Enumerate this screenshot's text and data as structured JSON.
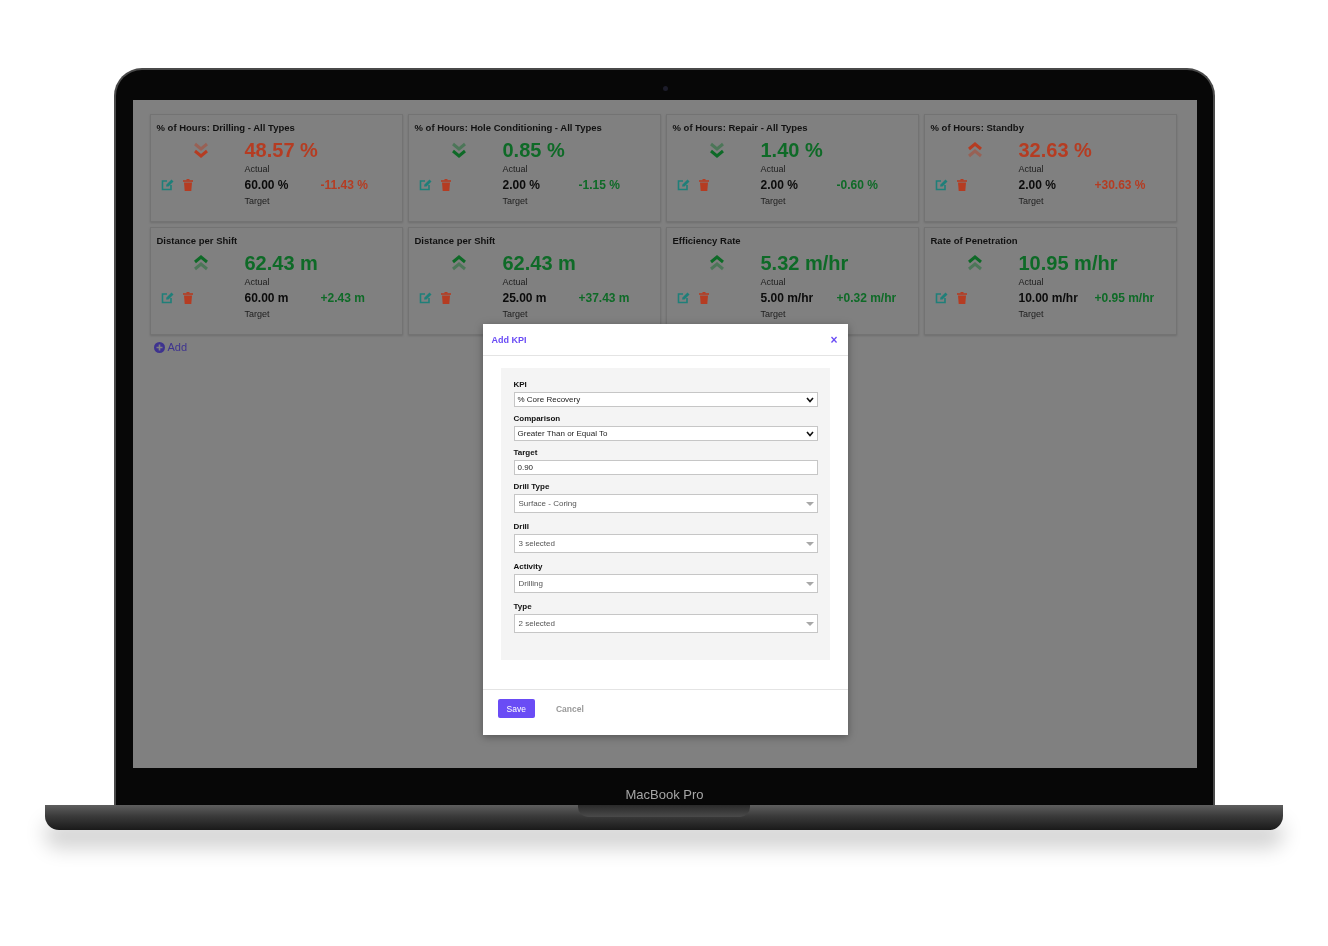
{
  "cards": [
    {
      "title": "% of Hours: Drilling - All Types",
      "rising": false,
      "on_target": false,
      "actual": "48.57 %",
      "actual_label": "Actual",
      "target": "60.00 %",
      "target_label": "Target",
      "difference": "-11.43 %"
    },
    {
      "title": "% of Hours: Hole Conditioning - All Types",
      "rising": false,
      "on_target": true,
      "actual": "0.85 %",
      "actual_label": "Actual",
      "target": "2.00 %",
      "target_label": "Target",
      "difference": "-1.15 %"
    },
    {
      "title": "% of Hours: Repair - All Types",
      "rising": false,
      "on_target": true,
      "actual": "1.40 %",
      "actual_label": "Actual",
      "target": "2.00 %",
      "target_label": "Target",
      "difference": "-0.60 %"
    },
    {
      "title": "% of Hours: Standby",
      "rising": true,
      "on_target": false,
      "actual": "32.63 %",
      "actual_label": "Actual",
      "target": "2.00 %",
      "target_label": "Target",
      "difference": "+30.63 %"
    },
    {
      "title": "Distance per Shift",
      "rising": true,
      "on_target": true,
      "actual": "62.43 m",
      "actual_label": "Actual",
      "target": "60.00 m",
      "target_label": "Target",
      "difference": "+2.43 m"
    },
    {
      "title": "Distance per Shift",
      "rising": true,
      "on_target": true,
      "actual": "62.43 m",
      "actual_label": "Actual",
      "target": "25.00 m",
      "target_label": "Target",
      "difference": "+37.43 m"
    },
    {
      "title": "Efficiency Rate",
      "rising": true,
      "on_target": true,
      "actual": "5.32 m/hr",
      "actual_label": "Actual",
      "target": "5.00 m/hr",
      "target_label": "Target",
      "difference": "+0.32 m/hr"
    },
    {
      "title": "Rate of Penetration",
      "rising": true,
      "on_target": true,
      "actual": "10.95 m/hr",
      "actual_label": "Actual",
      "target": "10.00 m/hr",
      "target_label": "Target",
      "difference": "+0.95 m/hr"
    }
  ],
  "add_link": "Add",
  "modal": {
    "title": "Add KPI",
    "close": "×",
    "fields": [
      {
        "label": "KPI",
        "kind": "select",
        "value": "% Core Recovery"
      },
      {
        "label": "Comparison",
        "kind": "select",
        "value": "Greater Than or Equal To"
      },
      {
        "label": "Target",
        "kind": "input",
        "value": "0.90"
      },
      {
        "label": "Drill Type",
        "kind": "dropdown",
        "value": "Surface - Coring"
      },
      {
        "label": "Drill",
        "kind": "dropdown",
        "value": "3 selected"
      },
      {
        "label": "Activity",
        "kind": "dropdown",
        "value": "Drilling"
      },
      {
        "label": "Type",
        "kind": "dropdown",
        "value": "2 selected"
      }
    ],
    "buttons": [
      {
        "label": "Save",
        "kind": "primary"
      },
      {
        "label": "Cancel",
        "kind": "secondary"
      }
    ]
  },
  "device_label": "MacBook Pro"
}
